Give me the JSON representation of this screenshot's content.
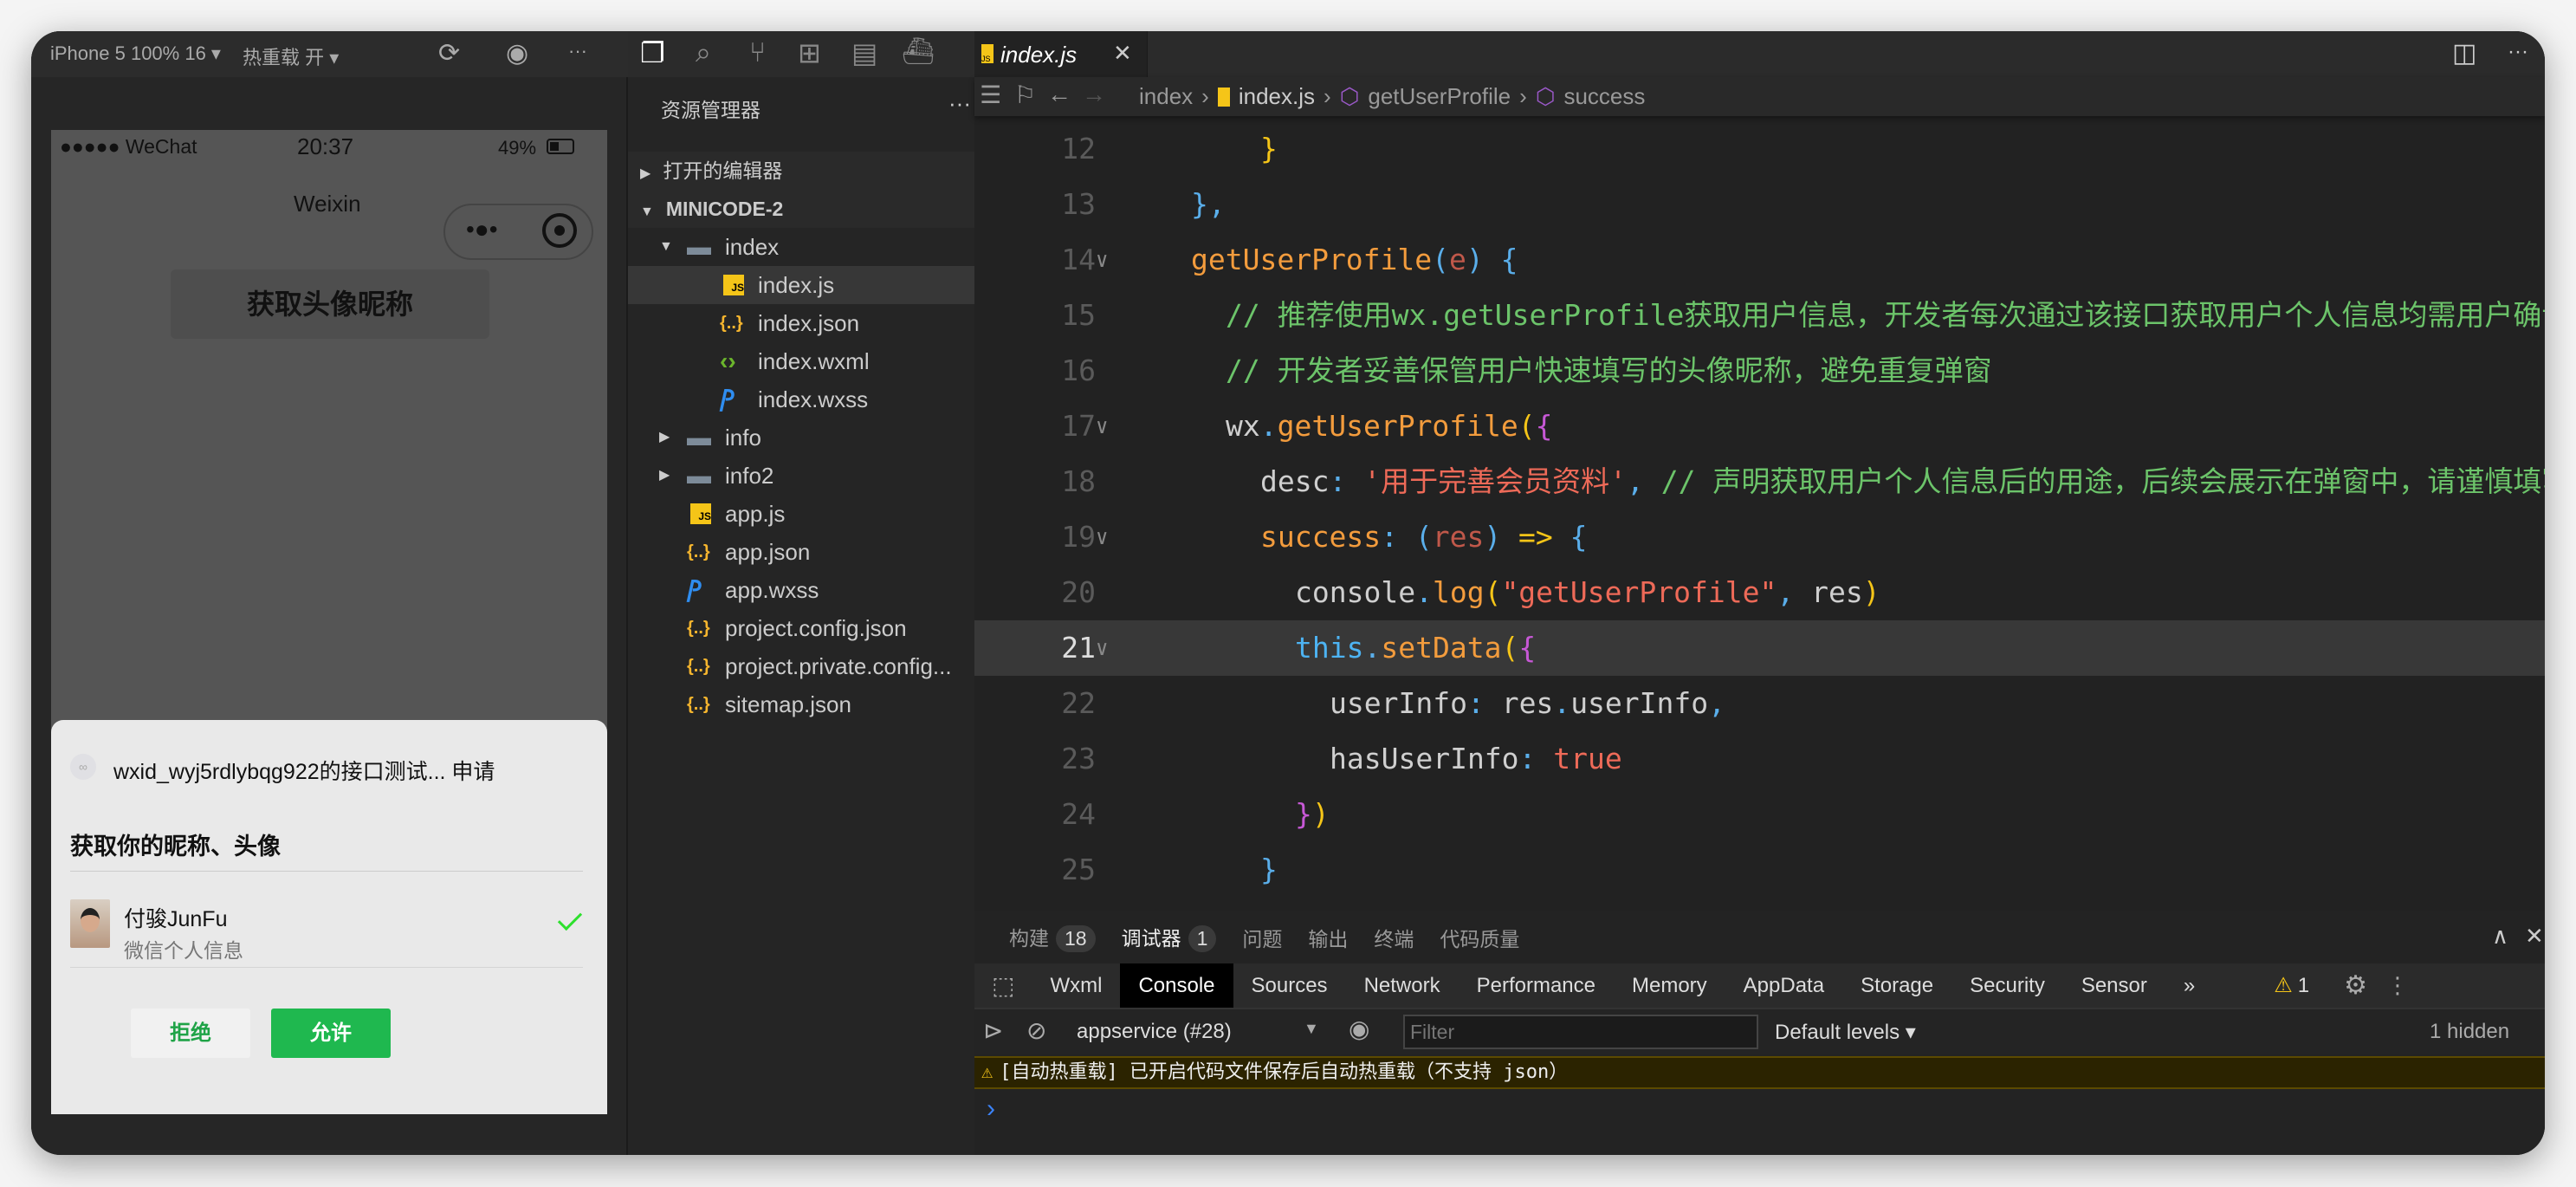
{
  "simulator": {
    "device_label": "iPhone 5 100% 16 ▾",
    "hot_reload_label": "热重载 开 ▾",
    "status": {
      "carrier": "●●●●● WeChat",
      "time": "20:37",
      "battery": "49%"
    },
    "nav_title": "Weixin",
    "page_button": "获取头像昵称",
    "dialog": {
      "app_line": "wxid_wyj5rdlybqg922的接口测试...  申请",
      "title": "获取你的昵称、头像",
      "user_name": "付骏JunFu",
      "user_sub": "微信个人信息",
      "reject": "拒绝",
      "allow": "允许"
    }
  },
  "explorer": {
    "title": "资源管理器",
    "more": "···",
    "open_editors": "打开的编辑器",
    "project": "MINICODE-2",
    "items": [
      {
        "label": "index",
        "type": "folder",
        "open": true,
        "depth": 1
      },
      {
        "label": "index.js",
        "type": "js",
        "depth": 2,
        "selected": true
      },
      {
        "label": "index.json",
        "type": "json",
        "depth": 2
      },
      {
        "label": "index.wxml",
        "type": "wxml",
        "depth": 2
      },
      {
        "label": "index.wxss",
        "type": "wxss",
        "depth": 2
      },
      {
        "label": "info",
        "type": "folder",
        "open": false,
        "depth": 1
      },
      {
        "label": "info2",
        "type": "folder",
        "open": false,
        "depth": 1
      },
      {
        "label": "app.js",
        "type": "js",
        "depth": 1
      },
      {
        "label": "app.json",
        "type": "json",
        "depth": 1
      },
      {
        "label": "app.wxss",
        "type": "wxss",
        "depth": 1
      },
      {
        "label": "project.config.json",
        "type": "json",
        "depth": 1
      },
      {
        "label": "project.private.config...",
        "type": "json",
        "depth": 1
      },
      {
        "label": "sitemap.json",
        "type": "json",
        "depth": 1
      }
    ]
  },
  "editor": {
    "tab": "index.js",
    "breadcrumb": [
      "index",
      "index.js",
      "getUserProfile",
      "success"
    ],
    "current_line": 21,
    "lines": [
      {
        "n": 12,
        "indent": 2,
        "tokens": [
          [
            "}",
            "y"
          ]
        ]
      },
      {
        "n": 13,
        "indent": 0,
        "tokens": [
          [
            "},",
            "pun"
          ]
        ]
      },
      {
        "n": 14,
        "indent": 0,
        "fold": true,
        "tokens": [
          [
            "getUserProfile",
            "fn"
          ],
          [
            "(",
            "pun"
          ],
          [
            "e",
            "par"
          ],
          [
            ")",
            "pun"
          ],
          [
            " {",
            "pun"
          ]
        ]
      },
      {
        "n": 15,
        "indent": 1,
        "tokens": [
          [
            "// 推荐使用wx.getUserProfile获取用户信息，开发者每次通过该接口获取用户个人信息均需用户确认",
            "com"
          ]
        ]
      },
      {
        "n": 16,
        "indent": 1,
        "tokens": [
          [
            "// 开发者妥善保管用户快速填写的头像昵称，避免重复弹窗",
            "com"
          ]
        ]
      },
      {
        "n": 17,
        "indent": 1,
        "fold": true,
        "tokens": [
          [
            "wx",
            "def"
          ],
          [
            ".",
            "pun"
          ],
          [
            "getUserProfile",
            "fn"
          ],
          [
            "(",
            "y"
          ],
          [
            "{",
            "m"
          ]
        ]
      },
      {
        "n": 18,
        "indent": 2,
        "tokens": [
          [
            "desc",
            "def"
          ],
          [
            ": ",
            "pun"
          ],
          [
            "'用于完善会员资料'",
            "str"
          ],
          [
            ", ",
            "pun"
          ],
          [
            "// 声明获取用户个人信息后的用途，后续会展示在弹窗中，请谨慎填写",
            "com"
          ]
        ]
      },
      {
        "n": 19,
        "indent": 2,
        "fold": true,
        "tokens": [
          [
            "success",
            "fn"
          ],
          [
            ": ",
            "pun"
          ],
          [
            "(",
            "pun"
          ],
          [
            "res",
            "par"
          ],
          [
            ")",
            "pun"
          ],
          [
            " => ",
            "y"
          ],
          [
            "{",
            "pun"
          ]
        ]
      },
      {
        "n": 20,
        "indent": 3,
        "tokens": [
          [
            "console",
            "def"
          ],
          [
            ".",
            "pun"
          ],
          [
            "log",
            "fn"
          ],
          [
            "(",
            "y"
          ],
          [
            "\"getUserProfile\"",
            "str"
          ],
          [
            ", ",
            "pun"
          ],
          [
            "res",
            "def"
          ],
          [
            ")",
            "y"
          ]
        ]
      },
      {
        "n": 21,
        "indent": 3,
        "fold": true,
        "tokens": [
          [
            "this",
            "kw"
          ],
          [
            ".",
            "pun"
          ],
          [
            "setData",
            "fn"
          ],
          [
            "(",
            "y"
          ],
          [
            "{",
            "m"
          ]
        ]
      },
      {
        "n": 22,
        "indent": 4,
        "tokens": [
          [
            "userInfo",
            "def"
          ],
          [
            ": ",
            "pun"
          ],
          [
            "res",
            "def"
          ],
          [
            ".",
            "pun"
          ],
          [
            "userInfo",
            "def"
          ],
          [
            ",",
            "pun"
          ]
        ]
      },
      {
        "n": 23,
        "indent": 4,
        "tokens": [
          [
            "hasUserInfo",
            "def"
          ],
          [
            ": ",
            "pun"
          ],
          [
            "true",
            "bool"
          ]
        ]
      },
      {
        "n": 24,
        "indent": 3,
        "tokens": [
          [
            "}",
            "m"
          ],
          [
            ")",
            "y"
          ]
        ]
      },
      {
        "n": 25,
        "indent": 2,
        "tokens": [
          [
            "}",
            "pun"
          ]
        ]
      }
    ]
  },
  "panel": {
    "tabs": [
      {
        "label": "构建",
        "badge": "18"
      },
      {
        "label": "调试器",
        "badge": "1",
        "selected": true
      },
      {
        "label": "问题"
      },
      {
        "label": "输出"
      },
      {
        "label": "终端"
      },
      {
        "label": "代码质量"
      }
    ],
    "devtools_tabs": [
      "Wxml",
      "Console",
      "Sources",
      "Network",
      "Performance",
      "Memory",
      "AppData",
      "Storage",
      "Security",
      "Sensor"
    ],
    "devtools_selected": "Console",
    "more_tabs": "»",
    "warning_count": "1",
    "context": "appservice (#28)",
    "filter_placeholder": "Filter",
    "levels": "Default levels ▾",
    "hidden": "1 hidden",
    "warning_message": "[自动热重载] 已开启代码文件保存后自动热重载（不支持 json）",
    "prompt": "›"
  },
  "colors": {
    "accent_green": "#1fb84f",
    "warning_bg": "#2b2300",
    "js_icon": "#f5c518",
    "wxss_icon": "#2f8df0"
  }
}
